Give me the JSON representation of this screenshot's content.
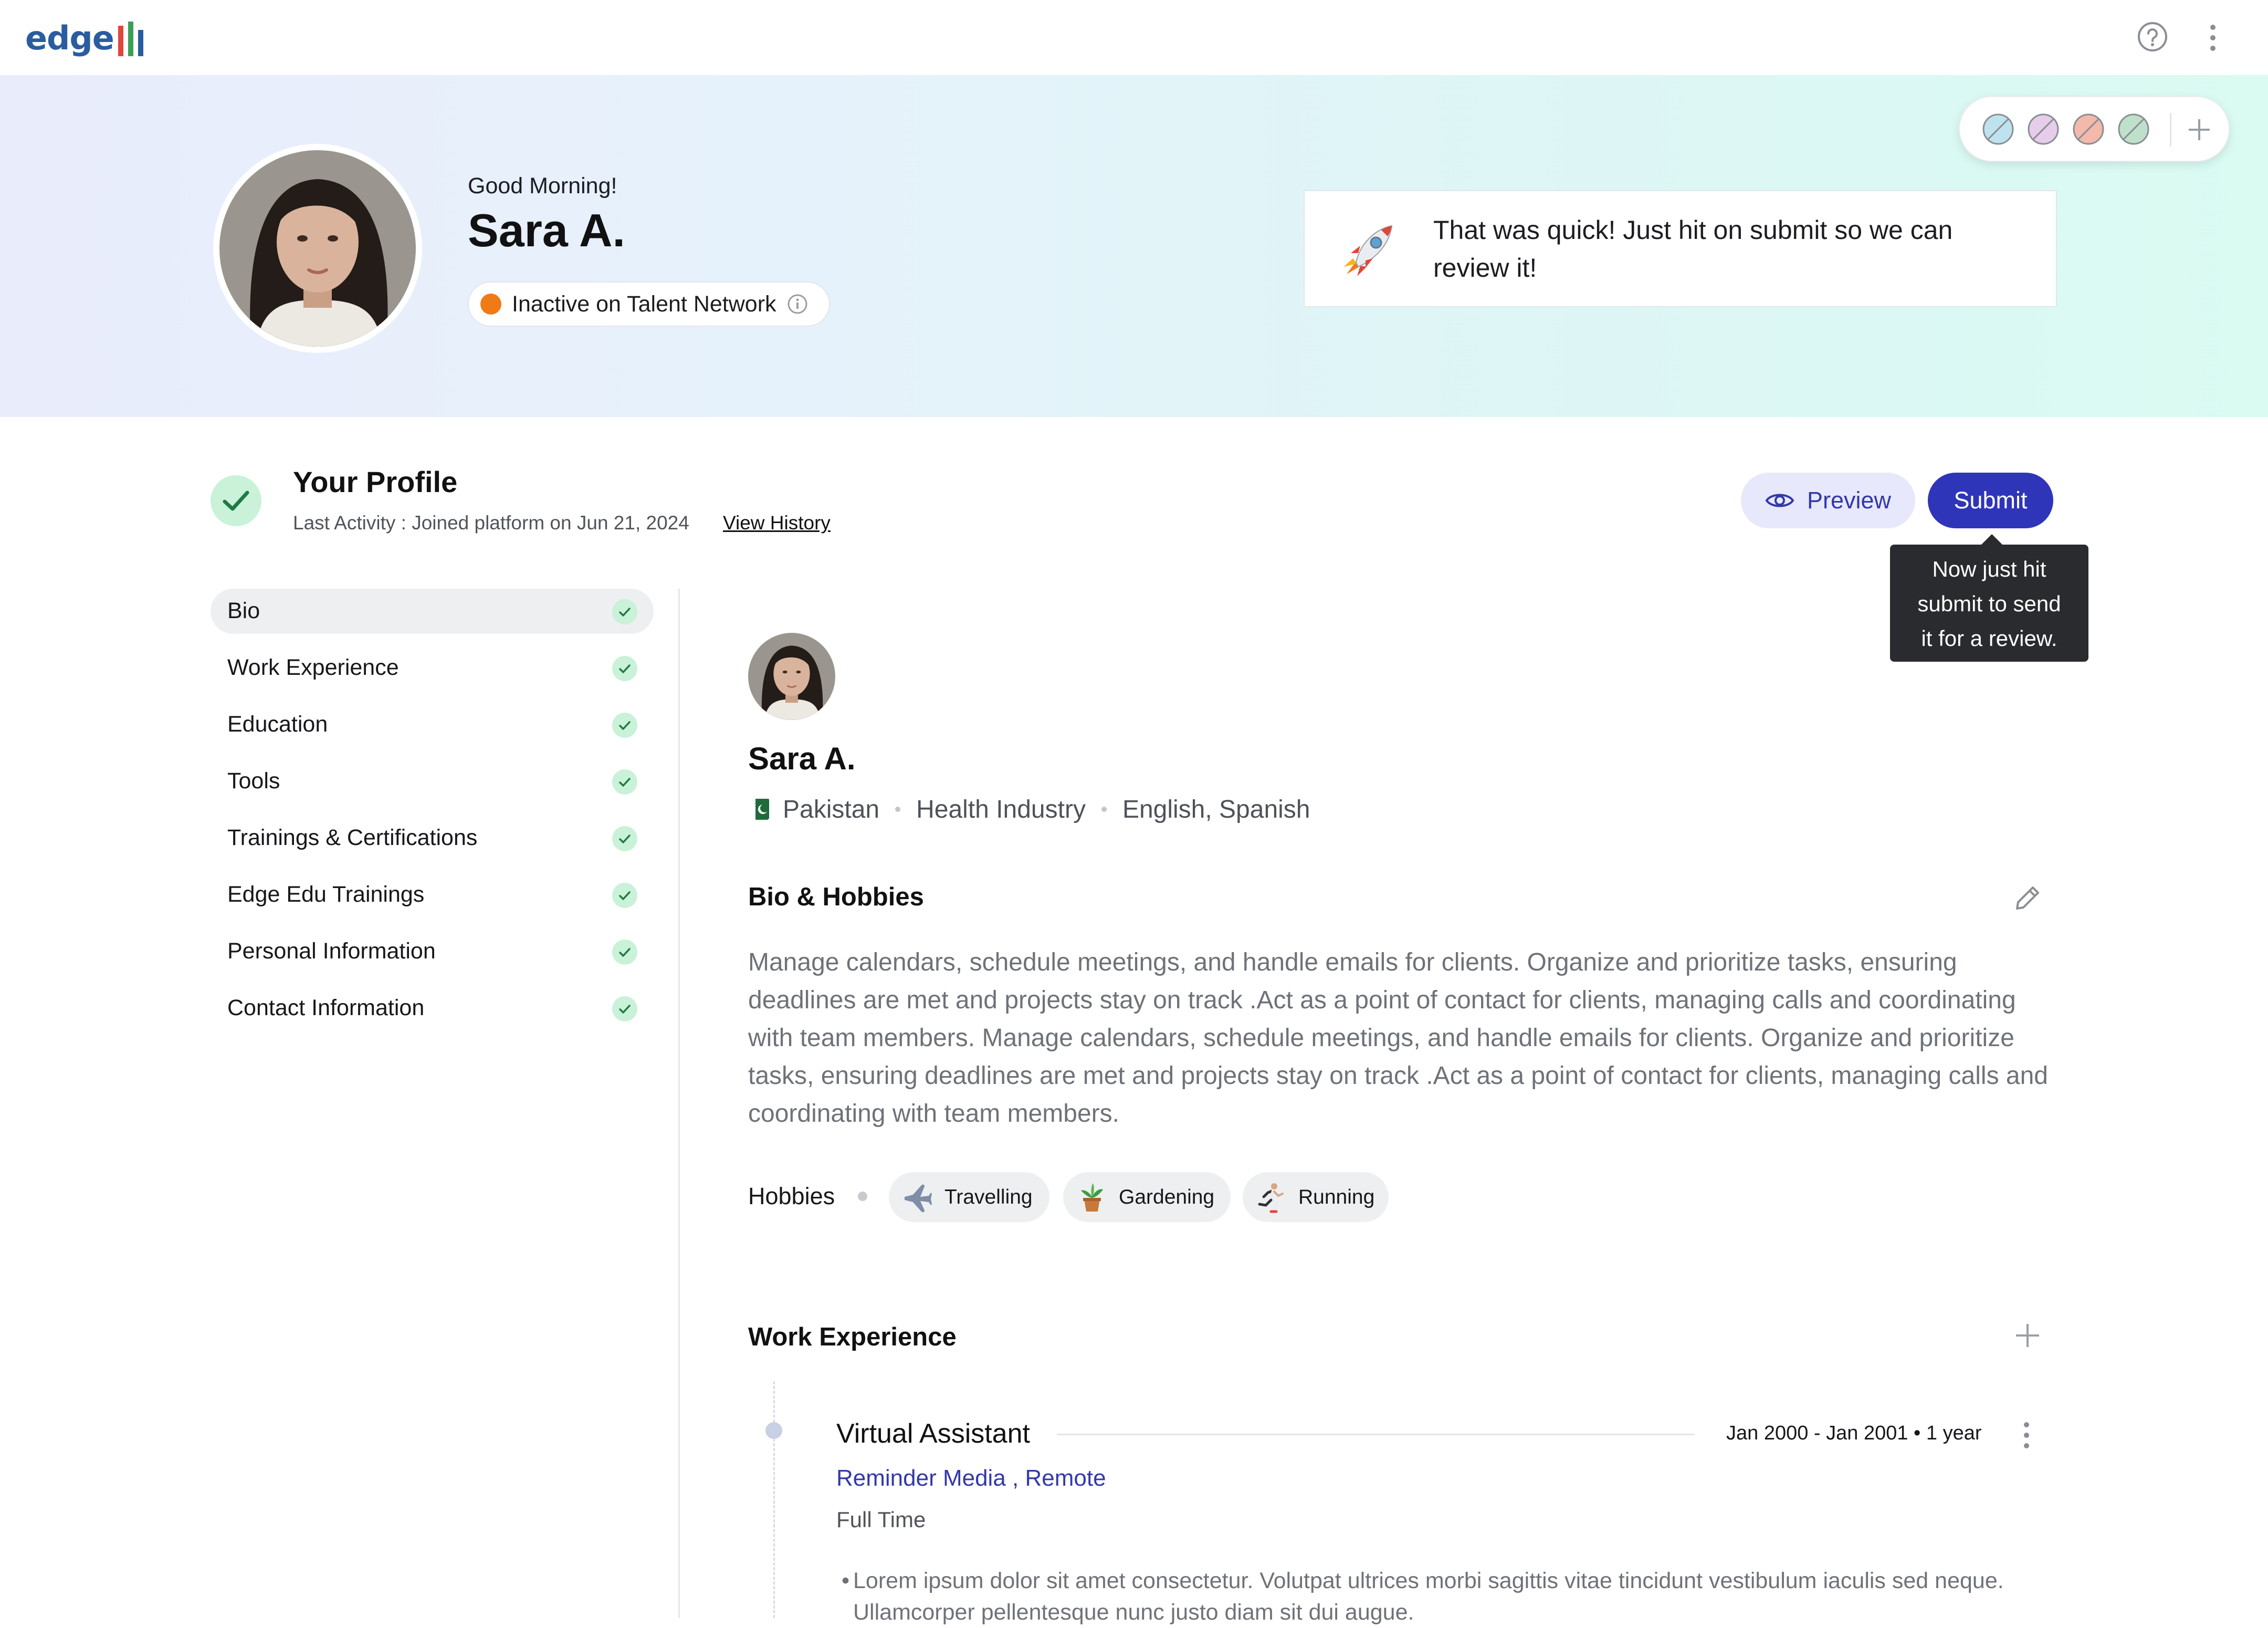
{
  "app": {
    "logo_text": "edge",
    "logo_bar_colors": [
      "#e0463a",
      "#3aa057",
      "#2a5d9f"
    ],
    "accent": "#2f35b8"
  },
  "topbar": {
    "help_icon": "help-circle-icon",
    "menu_icon": "kebab-menu-icon"
  },
  "hero": {
    "greeting": "Good Morning!",
    "name": "Sara A.",
    "status": {
      "label": "Inactive on Talent Network",
      "color": "#f07a16",
      "icon": "info-icon"
    },
    "theme_swatches": [
      {
        "color": "#bfe3ee",
        "name": "swatch-blue"
      },
      {
        "color": "#e6cdea",
        "name": "swatch-lilac"
      },
      {
        "color": "#f3b9ab",
        "name": "swatch-peach"
      },
      {
        "color": "#bfe0cb",
        "name": "swatch-green"
      }
    ],
    "toast": {
      "icon": "rocket-icon",
      "message": "That was quick! Just hit on submit so we can review it!"
    }
  },
  "profile": {
    "title": "Your Profile",
    "last_activity": "Last Activity : Joined platform on Jun 21, 2024",
    "view_history": "View History",
    "preview_label": "Preview",
    "submit_label": "Submit",
    "tooltip": [
      "Now just hit",
      "submit to send",
      "it for a review."
    ]
  },
  "sidebar": {
    "items": [
      {
        "label": "Bio",
        "active": true,
        "complete": true
      },
      {
        "label": "Work Experience",
        "active": false,
        "complete": true
      },
      {
        "label": "Education",
        "active": false,
        "complete": true
      },
      {
        "label": "Tools",
        "active": false,
        "complete": true
      },
      {
        "label": "Trainings & Certifications",
        "active": false,
        "complete": true
      },
      {
        "label": "Edge Edu Trainings",
        "active": false,
        "complete": true
      },
      {
        "label": "Personal Information",
        "active": false,
        "complete": true
      },
      {
        "label": "Contact Information",
        "active": false,
        "complete": true
      }
    ]
  },
  "main": {
    "name": "Sara A.",
    "country": "Pakistan",
    "industry": "Health Industry",
    "languages": "English, Spanish",
    "bio": {
      "title": "Bio & Hobbies",
      "text": "Manage calendars, schedule meetings, and handle emails for clients. Organize and prioritize tasks, ensuring deadlines are met and projects stay on track .Act as a point of contact for clients, managing calls and coordinating with team members. Manage calendars, schedule meetings, and handle emails for clients. Organize and prioritize tasks, ensuring deadlines are met and projects stay on track .Act as a point of contact for clients, managing calls and coordinating with team members.",
      "hobbies_label": "Hobbies",
      "hobbies": [
        {
          "label": "Travelling",
          "icon": "airplane-icon"
        },
        {
          "label": "Gardening",
          "icon": "potted-plant-icon"
        },
        {
          "label": "Running",
          "icon": "runner-icon"
        }
      ]
    },
    "work": {
      "title": "Work Experience",
      "jobs": [
        {
          "title": "Virtual Assistant",
          "dates": "Jan 2000 - Jan 2001 • 1 year",
          "company": "Reminder Media",
          "location": "Remote",
          "type": "Full Time",
          "bullets": [
            "Lorem ipsum dolor sit amet consectetur. Volutpat ultrices morbi sagittis vitae tincidunt vestibulum iaculis sed neque. Ullamcorper pellentesque nunc justo diam sit dui augue."
          ]
        }
      ]
    }
  }
}
